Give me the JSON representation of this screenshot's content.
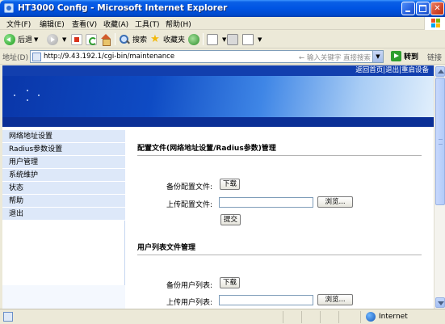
{
  "window": {
    "title": "HT3000 Config - Microsoft Internet Explorer"
  },
  "menubar": {
    "items": [
      "文件(F)",
      "编辑(E)",
      "查看(V)",
      "收藏(A)",
      "工具(T)",
      "帮助(H)"
    ]
  },
  "toolbar": {
    "back_label": "后退",
    "search_label": "搜索",
    "favorites_label": "收藏夹"
  },
  "addressbar": {
    "label": "地址(D)",
    "url": "http://9.43.192.1/cgi-bin/maintenance",
    "search_hint": "← 输入关键字 直接搜索",
    "go_label": "转到",
    "links_label": "链接"
  },
  "page": {
    "top_links": {
      "home": "返回首页",
      "sep": " | ",
      "logout": "退出",
      "restart": "重启设备"
    },
    "nav": {
      "items": [
        "网络地址设置",
        "Radius参数设置",
        "用户管理",
        "系统维护",
        "状态",
        "帮助",
        "退出"
      ]
    },
    "config_section": {
      "title": "配置文件(网络地址设置/Radius参数)管理",
      "backup_label": "备份配置文件:",
      "download_button": "下载",
      "upload_label": "上传配置文件:",
      "browse_button": "浏览...",
      "submit_button": "提交"
    },
    "userlist_section": {
      "title": "用户列表文件管理",
      "backup_label": "备份用户列表:",
      "download_button": "下载",
      "upload_label": "上传用户列表:",
      "browse_button": "浏览..."
    }
  },
  "statusbar": {
    "zone": "Internet"
  }
}
